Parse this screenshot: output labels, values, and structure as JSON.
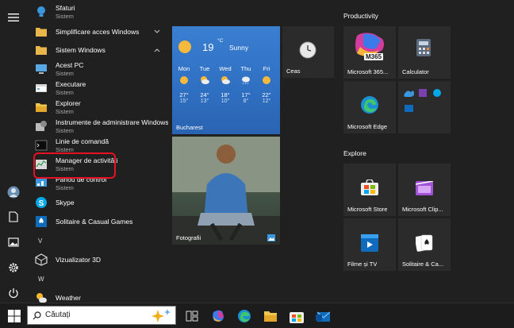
{
  "apps": [
    {
      "name": "Sfaturi",
      "sub": "Sistem",
      "icon": "tips-icon"
    },
    {
      "name": "Simplificare acces Windows",
      "icon": "folder-icon"
    },
    {
      "name": "Sistem Windows",
      "icon": "folder-icon"
    },
    {
      "name": "Acest PC",
      "sub": "Sistem",
      "icon": "pc-icon"
    },
    {
      "name": "Executare",
      "sub": "Sistem",
      "icon": "run-icon"
    },
    {
      "name": "Explorer",
      "sub": "Sistem",
      "icon": "explorer-icon"
    },
    {
      "name": "Instrumente de administrare Windows",
      "sub": "Sistem",
      "icon": "admin-tools-icon"
    },
    {
      "name": "Linie de comandă",
      "sub": "Sistem",
      "icon": "cmd-icon"
    },
    {
      "name": "Manager de activități",
      "sub": "Sistem",
      "icon": "task-manager-icon"
    },
    {
      "name": "Panou de control",
      "sub": "Sistem",
      "icon": "control-panel-icon"
    },
    {
      "name": "Skype",
      "icon": "skype-icon"
    },
    {
      "name": "Solitaire & Casual Games",
      "icon": "solitaire-icon"
    },
    {
      "name": "Vizualizator 3D",
      "icon": "3d-viewer-icon"
    },
    {
      "name": "Weather",
      "icon": "weather-icon"
    }
  ],
  "letters": [
    "V",
    "W"
  ],
  "weather": {
    "temp": "19",
    "unit": "°C",
    "cond": "Sunny",
    "city": "Bucharest",
    "days": [
      {
        "d": "Mon",
        "hi": "27°",
        "lo": "15°"
      },
      {
        "d": "Tue",
        "hi": "24°",
        "lo": "13°"
      },
      {
        "d": "Wed",
        "hi": "18°",
        "lo": "10°"
      },
      {
        "d": "Thu",
        "hi": "17°",
        "lo": "8°"
      },
      {
        "d": "Fri",
        "hi": "22°",
        "lo": "12°"
      }
    ]
  },
  "tiles": {
    "ceas": "Ceas",
    "fotografii": "Fotografii",
    "group_productivity": "Productivity",
    "group_explore": "Explore",
    "m365": "Microsoft 365...",
    "m365_badge": "M365",
    "calculator": "Calculator",
    "edge": "Microsoft Edge",
    "store": "Microsoft Store",
    "clip": "Microsoft Clip...",
    "films": "Filme și TV",
    "solitaire": "Solitaire & Ca..."
  },
  "search": {
    "placeholder": "Căutați"
  },
  "colors": {
    "highlight": "#e81123",
    "accent": "#0078d4"
  }
}
